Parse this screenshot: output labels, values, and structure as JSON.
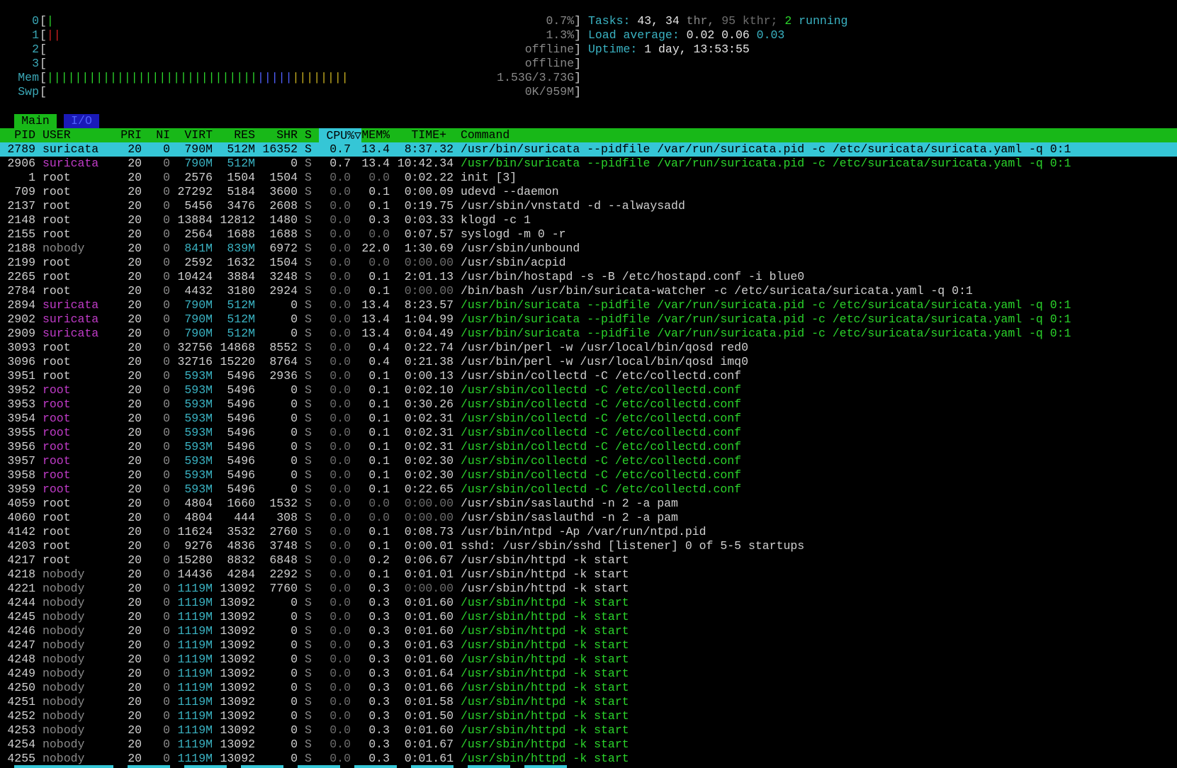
{
  "meters": {
    "cpus": [
      {
        "label": "0",
        "bar": "|",
        "bar_color": "#2bd42b",
        "value": "0.7%"
      },
      {
        "label": "1",
        "bar": "||",
        "bar_color": "#d02020",
        "value": "1.3%"
      },
      {
        "label": "2",
        "bar": "",
        "bar_color": "#2bd42b",
        "value": "offline"
      },
      {
        "label": "3",
        "bar": "",
        "bar_color": "#2bd42b",
        "value": "offline"
      }
    ],
    "mem": {
      "label": "Mem",
      "value": "1.53G/3.73G"
    },
    "swp": {
      "label": "Swp",
      "value": "0K/959M"
    }
  },
  "summary": {
    "tasks_label": "Tasks:",
    "tasks": "43,",
    "thr": "34",
    "thr_label": "thr,",
    "kthr": "95",
    "kthr_label": "kthr;",
    "running": "2",
    "running_label": "running",
    "load_label": "Load average:",
    "load1": "0.02",
    "load5": "0.06",
    "load15": "0.03",
    "uptime_label": "Uptime:",
    "uptime": "1 day, 13:53:55"
  },
  "tabs": {
    "main": "Main",
    "io": "I/O"
  },
  "header": {
    "pid": "PID",
    "user": "USER",
    "pri": "PRI",
    "ni": "NI",
    "virt": "VIRT",
    "res": "RES",
    "shr": "SHR",
    "s": "S",
    "cpu": "CPU%▽",
    "mem": "MEM%",
    "time": "TIME+",
    "command": "Command"
  },
  "colors": {
    "header_bg": "#18b818",
    "selected_bg": "#35c6d6",
    "thread_user": "#c03bc8",
    "thread_cmd": "#2bd42b"
  },
  "processes": [
    {
      "pid": "2789",
      "user": "suricata",
      "pri": "20",
      "ni": "0",
      "virt": "790M",
      "res": "512M",
      "shr": "16352",
      "s": "S",
      "cpu": "0.7",
      "mem": "13.4",
      "time": "8:37.32",
      "command": "/usr/bin/suricata --pidfile /var/run/suricata.pid -c /etc/suricata/suricata.yaml -q 0:1",
      "kind": "selected"
    },
    {
      "pid": "2906",
      "user": "suricata",
      "pri": "20",
      "ni": "0",
      "virt": "790M",
      "res": "512M",
      "shr": "0",
      "s": "S",
      "cpu": "0.7",
      "mem": "13.4",
      "time": "10:42.34",
      "command": "/usr/bin/suricata --pidfile /var/run/suricata.pid -c /etc/suricata/suricata.yaml -q 0:1",
      "kind": "thread"
    },
    {
      "pid": "1",
      "user": "root",
      "pri": "20",
      "ni": "0",
      "virt": "2576",
      "res": "1504",
      "shr": "1504",
      "s": "S",
      "cpu": "0.0",
      "mem": "0.0",
      "time": "0:02.22",
      "command": "init [3]",
      "kind": "normal"
    },
    {
      "pid": "709",
      "user": "root",
      "pri": "20",
      "ni": "0",
      "virt": "27292",
      "res": "5184",
      "shr": "3600",
      "s": "S",
      "cpu": "0.0",
      "mem": "0.1",
      "time": "0:00.09",
      "command": "udevd --daemon",
      "kind": "normal"
    },
    {
      "pid": "2137",
      "user": "root",
      "pri": "20",
      "ni": "0",
      "virt": "5456",
      "res": "3476",
      "shr": "2608",
      "s": "S",
      "cpu": "0.0",
      "mem": "0.1",
      "time": "0:19.75",
      "command": "/usr/sbin/vnstatd -d --alwaysadd",
      "kind": "normal"
    },
    {
      "pid": "2148",
      "user": "root",
      "pri": "20",
      "ni": "0",
      "virt": "13884",
      "res": "12812",
      "shr": "1480",
      "s": "S",
      "cpu": "0.0",
      "mem": "0.3",
      "time": "0:03.33",
      "command": "klogd -c 1",
      "kind": "normal"
    },
    {
      "pid": "2155",
      "user": "root",
      "pri": "20",
      "ni": "0",
      "virt": "2564",
      "res": "1688",
      "shr": "1688",
      "s": "S",
      "cpu": "0.0",
      "mem": "0.0",
      "time": "0:07.57",
      "command": "syslogd -m 0 -r",
      "kind": "normal"
    },
    {
      "pid": "2188",
      "user": "nobody",
      "pri": "20",
      "ni": "0",
      "virt": "841M",
      "res": "839M",
      "shr": "6972",
      "s": "S",
      "cpu": "0.0",
      "mem": "22.0",
      "time": "1:30.69",
      "command": "/usr/sbin/unbound",
      "kind": "normal"
    },
    {
      "pid": "2199",
      "user": "root",
      "pri": "20",
      "ni": "0",
      "virt": "2592",
      "res": "1632",
      "shr": "1504",
      "s": "S",
      "cpu": "0.0",
      "mem": "0.0",
      "time": "0:00.00",
      "command": "/usr/sbin/acpid",
      "kind": "normal"
    },
    {
      "pid": "2265",
      "user": "root",
      "pri": "20",
      "ni": "0",
      "virt": "10424",
      "res": "3884",
      "shr": "3248",
      "s": "S",
      "cpu": "0.0",
      "mem": "0.1",
      "time": "2:01.13",
      "command": "/usr/bin/hostapd -s -B /etc/hostapd.conf -i blue0",
      "kind": "normal"
    },
    {
      "pid": "2784",
      "user": "root",
      "pri": "20",
      "ni": "0",
      "virt": "4432",
      "res": "3180",
      "shr": "2924",
      "s": "S",
      "cpu": "0.0",
      "mem": "0.1",
      "time": "0:00.00",
      "command": "/bin/bash /usr/bin/suricata-watcher -c /etc/suricata/suricata.yaml -q 0:1",
      "kind": "normal"
    },
    {
      "pid": "2894",
      "user": "suricata",
      "pri": "20",
      "ni": "0",
      "virt": "790M",
      "res": "512M",
      "shr": "0",
      "s": "S",
      "cpu": "0.0",
      "mem": "13.4",
      "time": "8:23.57",
      "command": "/usr/bin/suricata --pidfile /var/run/suricata.pid -c /etc/suricata/suricata.yaml -q 0:1",
      "kind": "thread"
    },
    {
      "pid": "2902",
      "user": "suricata",
      "pri": "20",
      "ni": "0",
      "virt": "790M",
      "res": "512M",
      "shr": "0",
      "s": "S",
      "cpu": "0.0",
      "mem": "13.4",
      "time": "1:04.99",
      "command": "/usr/bin/suricata --pidfile /var/run/suricata.pid -c /etc/suricata/suricata.yaml -q 0:1",
      "kind": "thread"
    },
    {
      "pid": "2909",
      "user": "suricata",
      "pri": "20",
      "ni": "0",
      "virt": "790M",
      "res": "512M",
      "shr": "0",
      "s": "S",
      "cpu": "0.0",
      "mem": "13.4",
      "time": "0:04.49",
      "command": "/usr/bin/suricata --pidfile /var/run/suricata.pid -c /etc/suricata/suricata.yaml -q 0:1",
      "kind": "thread"
    },
    {
      "pid": "3093",
      "user": "root",
      "pri": "20",
      "ni": "0",
      "virt": "32756",
      "res": "14868",
      "shr": "8552",
      "s": "S",
      "cpu": "0.0",
      "mem": "0.4",
      "time": "0:22.74",
      "command": "/usr/bin/perl -w /usr/local/bin/qosd red0",
      "kind": "normal"
    },
    {
      "pid": "3096",
      "user": "root",
      "pri": "20",
      "ni": "0",
      "virt": "32716",
      "res": "15220",
      "shr": "8764",
      "s": "S",
      "cpu": "0.0",
      "mem": "0.4",
      "time": "0:21.38",
      "command": "/usr/bin/perl -w /usr/local/bin/qosd imq0",
      "kind": "normal"
    },
    {
      "pid": "3951",
      "user": "root",
      "pri": "20",
      "ni": "0",
      "virt": "593M",
      "res": "5496",
      "shr": "2936",
      "s": "S",
      "cpu": "0.0",
      "mem": "0.1",
      "time": "0:00.13",
      "command": "/usr/sbin/collectd -C /etc/collectd.conf",
      "kind": "normal"
    },
    {
      "pid": "3952",
      "user": "root",
      "pri": "20",
      "ni": "0",
      "virt": "593M",
      "res": "5496",
      "shr": "0",
      "s": "S",
      "cpu": "0.0",
      "mem": "0.1",
      "time": "0:02.10",
      "command": "/usr/sbin/collectd -C /etc/collectd.conf",
      "kind": "thread"
    },
    {
      "pid": "3953",
      "user": "root",
      "pri": "20",
      "ni": "0",
      "virt": "593M",
      "res": "5496",
      "shr": "0",
      "s": "S",
      "cpu": "0.0",
      "mem": "0.1",
      "time": "0:30.26",
      "command": "/usr/sbin/collectd -C /etc/collectd.conf",
      "kind": "thread"
    },
    {
      "pid": "3954",
      "user": "root",
      "pri": "20",
      "ni": "0",
      "virt": "593M",
      "res": "5496",
      "shr": "0",
      "s": "S",
      "cpu": "0.0",
      "mem": "0.1",
      "time": "0:02.31",
      "command": "/usr/sbin/collectd -C /etc/collectd.conf",
      "kind": "thread"
    },
    {
      "pid": "3955",
      "user": "root",
      "pri": "20",
      "ni": "0",
      "virt": "593M",
      "res": "5496",
      "shr": "0",
      "s": "S",
      "cpu": "0.0",
      "mem": "0.1",
      "time": "0:02.31",
      "command": "/usr/sbin/collectd -C /etc/collectd.conf",
      "kind": "thread"
    },
    {
      "pid": "3956",
      "user": "root",
      "pri": "20",
      "ni": "0",
      "virt": "593M",
      "res": "5496",
      "shr": "0",
      "s": "S",
      "cpu": "0.0",
      "mem": "0.1",
      "time": "0:02.31",
      "command": "/usr/sbin/collectd -C /etc/collectd.conf",
      "kind": "thread"
    },
    {
      "pid": "3957",
      "user": "root",
      "pri": "20",
      "ni": "0",
      "virt": "593M",
      "res": "5496",
      "shr": "0",
      "s": "S",
      "cpu": "0.0",
      "mem": "0.1",
      "time": "0:02.30",
      "command": "/usr/sbin/collectd -C /etc/collectd.conf",
      "kind": "thread"
    },
    {
      "pid": "3958",
      "user": "root",
      "pri": "20",
      "ni": "0",
      "virt": "593M",
      "res": "5496",
      "shr": "0",
      "s": "S",
      "cpu": "0.0",
      "mem": "0.1",
      "time": "0:02.30",
      "command": "/usr/sbin/collectd -C /etc/collectd.conf",
      "kind": "thread"
    },
    {
      "pid": "3959",
      "user": "root",
      "pri": "20",
      "ni": "0",
      "virt": "593M",
      "res": "5496",
      "shr": "0",
      "s": "S",
      "cpu": "0.0",
      "mem": "0.1",
      "time": "0:22.65",
      "command": "/usr/sbin/collectd -C /etc/collectd.conf",
      "kind": "thread"
    },
    {
      "pid": "4059",
      "user": "root",
      "pri": "20",
      "ni": "0",
      "virt": "4804",
      "res": "1660",
      "shr": "1532",
      "s": "S",
      "cpu": "0.0",
      "mem": "0.0",
      "time": "0:00.00",
      "command": "/usr/sbin/saslauthd -n 2 -a pam",
      "kind": "normal"
    },
    {
      "pid": "4060",
      "user": "root",
      "pri": "20",
      "ni": "0",
      "virt": "4804",
      "res": "444",
      "shr": "308",
      "s": "S",
      "cpu": "0.0",
      "mem": "0.0",
      "time": "0:00.00",
      "command": "/usr/sbin/saslauthd -n 2 -a pam",
      "kind": "normal"
    },
    {
      "pid": "4142",
      "user": "root",
      "pri": "20",
      "ni": "0",
      "virt": "11624",
      "res": "3532",
      "shr": "2760",
      "s": "S",
      "cpu": "0.0",
      "mem": "0.1",
      "time": "0:08.73",
      "command": "/usr/bin/ntpd -Ap /var/run/ntpd.pid",
      "kind": "normal"
    },
    {
      "pid": "4203",
      "user": "root",
      "pri": "20",
      "ni": "0",
      "virt": "9276",
      "res": "4836",
      "shr": "3748",
      "s": "S",
      "cpu": "0.0",
      "mem": "0.1",
      "time": "0:00.01",
      "command": "sshd: /usr/sbin/sshd [listener] 0 of 5-5 startups",
      "kind": "normal"
    },
    {
      "pid": "4217",
      "user": "root",
      "pri": "20",
      "ni": "0",
      "virt": "15280",
      "res": "8832",
      "shr": "6848",
      "s": "S",
      "cpu": "0.0",
      "mem": "0.2",
      "time": "0:06.67",
      "command": "/usr/sbin/httpd -k start",
      "kind": "normal"
    },
    {
      "pid": "4218",
      "user": "nobody",
      "pri": "20",
      "ni": "0",
      "virt": "14436",
      "res": "4284",
      "shr": "2292",
      "s": "S",
      "cpu": "0.0",
      "mem": "0.1",
      "time": "0:01.01",
      "command": "/usr/sbin/httpd -k start",
      "kind": "normal"
    },
    {
      "pid": "4221",
      "user": "nobody",
      "pri": "20",
      "ni": "0",
      "virt": "1119M",
      "res": "13092",
      "shr": "7760",
      "s": "S",
      "cpu": "0.0",
      "mem": "0.3",
      "time": "0:00.00",
      "command": "/usr/sbin/httpd -k start",
      "kind": "normal"
    },
    {
      "pid": "4244",
      "user": "nobody",
      "pri": "20",
      "ni": "0",
      "virt": "1119M",
      "res": "13092",
      "shr": "0",
      "s": "S",
      "cpu": "0.0",
      "mem": "0.3",
      "time": "0:01.60",
      "command": "/usr/sbin/httpd -k start",
      "kind": "thread2"
    },
    {
      "pid": "4245",
      "user": "nobody",
      "pri": "20",
      "ni": "0",
      "virt": "1119M",
      "res": "13092",
      "shr": "0",
      "s": "S",
      "cpu": "0.0",
      "mem": "0.3",
      "time": "0:01.60",
      "command": "/usr/sbin/httpd -k start",
      "kind": "thread2"
    },
    {
      "pid": "4246",
      "user": "nobody",
      "pri": "20",
      "ni": "0",
      "virt": "1119M",
      "res": "13092",
      "shr": "0",
      "s": "S",
      "cpu": "0.0",
      "mem": "0.3",
      "time": "0:01.60",
      "command": "/usr/sbin/httpd -k start",
      "kind": "thread2"
    },
    {
      "pid": "4247",
      "user": "nobody",
      "pri": "20",
      "ni": "0",
      "virt": "1119M",
      "res": "13092",
      "shr": "0",
      "s": "S",
      "cpu": "0.0",
      "mem": "0.3",
      "time": "0:01.63",
      "command": "/usr/sbin/httpd -k start",
      "kind": "thread2"
    },
    {
      "pid": "4248",
      "user": "nobody",
      "pri": "20",
      "ni": "0",
      "virt": "1119M",
      "res": "13092",
      "shr": "0",
      "s": "S",
      "cpu": "0.0",
      "mem": "0.3",
      "time": "0:01.60",
      "command": "/usr/sbin/httpd -k start",
      "kind": "thread2"
    },
    {
      "pid": "4249",
      "user": "nobody",
      "pri": "20",
      "ni": "0",
      "virt": "1119M",
      "res": "13092",
      "shr": "0",
      "s": "S",
      "cpu": "0.0",
      "mem": "0.3",
      "time": "0:01.64",
      "command": "/usr/sbin/httpd -k start",
      "kind": "thread2"
    },
    {
      "pid": "4250",
      "user": "nobody",
      "pri": "20",
      "ni": "0",
      "virt": "1119M",
      "res": "13092",
      "shr": "0",
      "s": "S",
      "cpu": "0.0",
      "mem": "0.3",
      "time": "0:01.66",
      "command": "/usr/sbin/httpd -k start",
      "kind": "thread2"
    },
    {
      "pid": "4251",
      "user": "nobody",
      "pri": "20",
      "ni": "0",
      "virt": "1119M",
      "res": "13092",
      "shr": "0",
      "s": "S",
      "cpu": "0.0",
      "mem": "0.3",
      "time": "0:01.58",
      "command": "/usr/sbin/httpd -k start",
      "kind": "thread2"
    },
    {
      "pid": "4252",
      "user": "nobody",
      "pri": "20",
      "ni": "0",
      "virt": "1119M",
      "res": "13092",
      "shr": "0",
      "s": "S",
      "cpu": "0.0",
      "mem": "0.3",
      "time": "0:01.50",
      "command": "/usr/sbin/httpd -k start",
      "kind": "thread2"
    },
    {
      "pid": "4253",
      "user": "nobody",
      "pri": "20",
      "ni": "0",
      "virt": "1119M",
      "res": "13092",
      "shr": "0",
      "s": "S",
      "cpu": "0.0",
      "mem": "0.3",
      "time": "0:01.60",
      "command": "/usr/sbin/httpd -k start",
      "kind": "thread2"
    },
    {
      "pid": "4254",
      "user": "nobody",
      "pri": "20",
      "ni": "0",
      "virt": "1119M",
      "res": "13092",
      "shr": "0",
      "s": "S",
      "cpu": "0.0",
      "mem": "0.3",
      "time": "0:01.67",
      "command": "/usr/sbin/httpd -k start",
      "kind": "thread2"
    },
    {
      "pid": "4255",
      "user": "nobody",
      "pri": "20",
      "ni": "0",
      "virt": "1119M",
      "res": "13092",
      "shr": "0",
      "s": "S",
      "cpu": "0.0",
      "mem": "0.3",
      "time": "0:01.61",
      "command": "/usr/sbin/httpd -k start",
      "kind": "thread2"
    }
  ]
}
